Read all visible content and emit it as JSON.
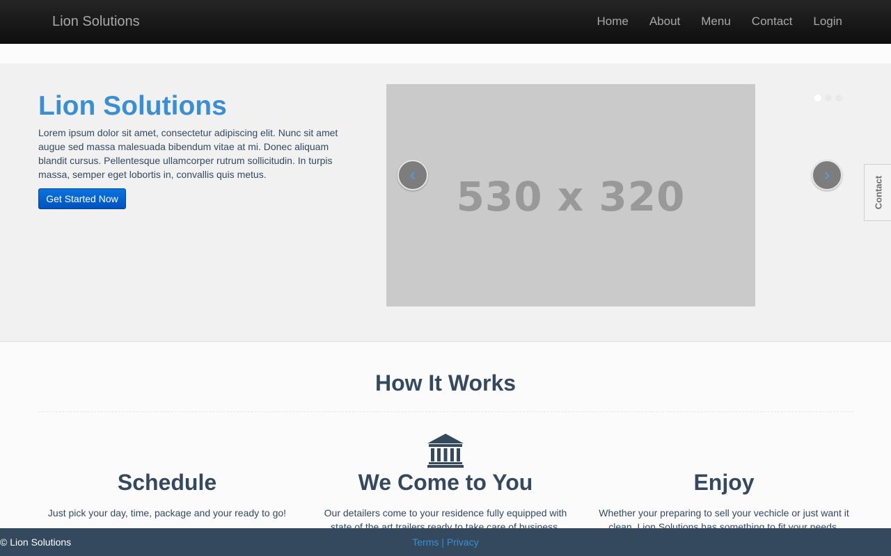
{
  "navbar": {
    "brand": "Lion Solutions",
    "items": [
      "Home",
      "About",
      "Menu",
      "Contact",
      "Login"
    ]
  },
  "hero": {
    "title": "Lion Solutions",
    "text": "Lorem ipsum dolor sit amet, consectetur adipiscing elit. Nunc sit amet augue sed massa malesuada bibendum vitae at mi. Donec aliquam blandit cursus. Pellentesque ullamcorper rutrum sollicitudin. In turpis massa, semper eget lobortis in, convallis quis metus.",
    "cta_label": "Get Started Now",
    "slide_label": "530 x 320",
    "prev_glyph": "‹",
    "next_glyph": "›",
    "slide_count": 3,
    "active_slide": 1
  },
  "contact_tab": "Contact",
  "how_it_works": {
    "title": "How It Works",
    "icon": "bank-icon",
    "steps": [
      {
        "title": "Schedule",
        "text": "Just pick your day, time, package and your ready to go!"
      },
      {
        "title": "We Come to You",
        "text": "Our detailers come to your residence fully equipped with state of the art trailers ready to take care of business."
      },
      {
        "title": "Enjoy",
        "text": "Whether your preparing to sell your vechicle or just want it clean, Lion Solutions has something to fit your needs."
      }
    ]
  },
  "footer": {
    "copyright": "© Lion Solutions",
    "links": [
      "Terms",
      "Privacy"
    ],
    "separator": "|"
  },
  "colors": {
    "accent": "#3a8fd3",
    "text": "#34495e",
    "footer_bg": "#34495e",
    "cta": "#0b74dd"
  }
}
